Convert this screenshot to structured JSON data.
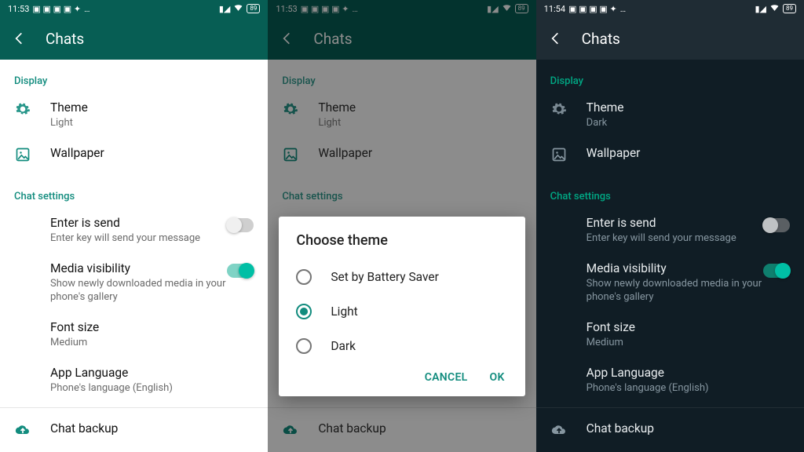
{
  "status": {
    "time_light": "11:53",
    "time_mid": "11:53",
    "time_dark": "11:54",
    "battery": "89",
    "dots": "…"
  },
  "header": {
    "title": "Chats"
  },
  "sections": {
    "display": "Display",
    "chat": "Chat settings"
  },
  "rows": {
    "theme": {
      "title": "Theme",
      "sub_light": "Light",
      "sub_dark": "Dark"
    },
    "wallpaper": {
      "title": "Wallpaper"
    },
    "enter": {
      "title": "Enter is send",
      "sub": "Enter key will send your message"
    },
    "media": {
      "title": "Media visibility",
      "sub": "Show newly downloaded media in your phone's gallery"
    },
    "font": {
      "title": "Font size",
      "sub": "Medium"
    },
    "lang": {
      "title": "App Language",
      "sub": "Phone's language (English)"
    },
    "backup": {
      "title": "Chat backup"
    }
  },
  "dialog": {
    "title": "Choose theme",
    "opt_battery": "Set by Battery Saver",
    "opt_light": "Light",
    "opt_dark": "Dark",
    "cancel": "CANCEL",
    "ok": "OK"
  },
  "icons": {
    "theme": "gear-icon",
    "wallpaper": "wallpaper-icon",
    "backup": "cloud-upload-icon"
  }
}
